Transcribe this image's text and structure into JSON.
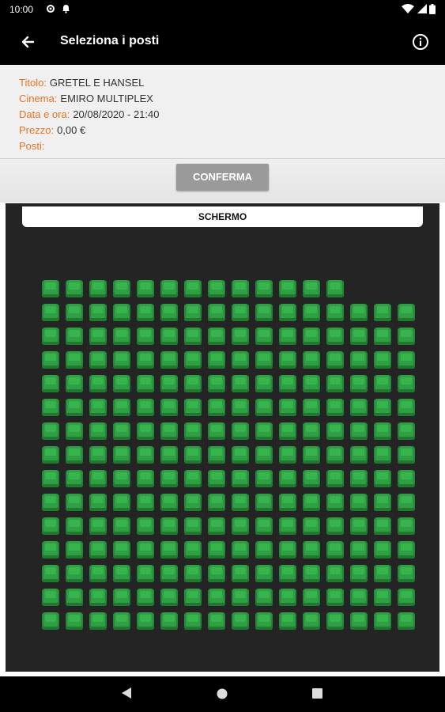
{
  "status_bar": {
    "time": "10:00",
    "left_icons": [
      "gear-icon",
      "bell-icon"
    ],
    "right_icons": [
      "wifi-icon",
      "battery-icon"
    ]
  },
  "app_bar": {
    "title": "Seleziona i posti",
    "back_icon": "arrow-left-icon",
    "info_icon": "info-icon"
  },
  "details": {
    "title_label": "Titolo:",
    "title_value": "GRETEL E HANSEL",
    "cinema_label": "Cinema:",
    "cinema_value": "EMIRO MULTIPLEX",
    "datetime_label": "Data e ora:",
    "datetime_value": "20/08/2020 - 21:40",
    "price_label": "Prezzo:",
    "price_value": "0,00 €",
    "seats_label": "Posti:",
    "seats_value": ""
  },
  "actions": {
    "confirm_label": "CONFERMA"
  },
  "hall": {
    "screen_label": "SCHERMO",
    "rows": [
      {
        "seats": 13
      },
      {
        "seats": 16
      },
      {
        "seats": 16
      },
      {
        "seats": 16
      },
      {
        "seats": 16
      },
      {
        "seats": 16
      },
      {
        "seats": 16
      },
      {
        "seats": 16
      },
      {
        "seats": 16
      },
      {
        "seats": 16
      },
      {
        "seats": 16
      },
      {
        "seats": 16
      },
      {
        "seats": 16
      },
      {
        "seats": 16
      },
      {
        "seats": 16
      }
    ],
    "seat_state": "available",
    "colors": {
      "seat_available": "#2ea043",
      "hall_background": "#242424",
      "label_accent": "#e8731f"
    }
  },
  "nav_bar": {
    "buttons": [
      "back-triangle-icon",
      "home-circle-icon",
      "recents-square-icon"
    ]
  }
}
